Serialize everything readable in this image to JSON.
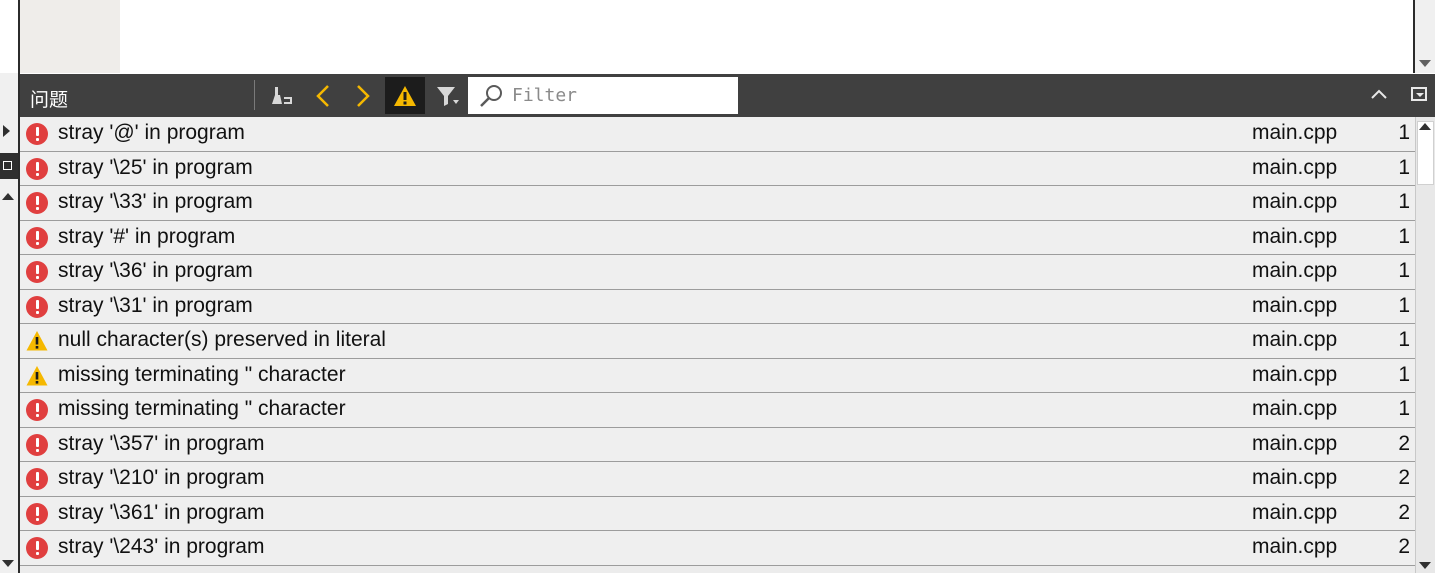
{
  "panel": {
    "title": "问题",
    "filter_placeholder": "Filter"
  },
  "toolbar_icons": [
    "clear-broom-icon",
    "chevron-left-icon",
    "chevron-right-icon",
    "warning-filter-icon",
    "funnel-filter-icon",
    "magnifier-icon",
    "chevron-up-icon",
    "panel-menu-icon"
  ],
  "colors": {
    "error": "#e03f3f",
    "warning": "#f5b800",
    "toolbar": "#404040"
  },
  "issues": [
    {
      "severity": "error",
      "message": "stray '@' in program",
      "file": "main.cpp",
      "line": "1"
    },
    {
      "severity": "error",
      "message": "stray '\\25' in program",
      "file": "main.cpp",
      "line": "1"
    },
    {
      "severity": "error",
      "message": "stray '\\33' in program",
      "file": "main.cpp",
      "line": "1"
    },
    {
      "severity": "error",
      "message": "stray '#' in program",
      "file": "main.cpp",
      "line": "1"
    },
    {
      "severity": "error",
      "message": "stray '\\36' in program",
      "file": "main.cpp",
      "line": "1"
    },
    {
      "severity": "error",
      "message": "stray '\\31' in program",
      "file": "main.cpp",
      "line": "1"
    },
    {
      "severity": "warning",
      "message": "null character(s) preserved in literal",
      "file": "main.cpp",
      "line": "1"
    },
    {
      "severity": "warning",
      "message": "missing terminating \" character",
      "file": "main.cpp",
      "line": "1"
    },
    {
      "severity": "error",
      "message": "missing terminating \" character",
      "file": "main.cpp",
      "line": "1"
    },
    {
      "severity": "error",
      "message": "stray '\\357' in program",
      "file": "main.cpp",
      "line": "2"
    },
    {
      "severity": "error",
      "message": "stray '\\210' in program",
      "file": "main.cpp",
      "line": "2"
    },
    {
      "severity": "error",
      "message": "stray '\\361' in program",
      "file": "main.cpp",
      "line": "2"
    },
    {
      "severity": "error",
      "message": "stray '\\243' in program",
      "file": "main.cpp",
      "line": "2"
    }
  ]
}
